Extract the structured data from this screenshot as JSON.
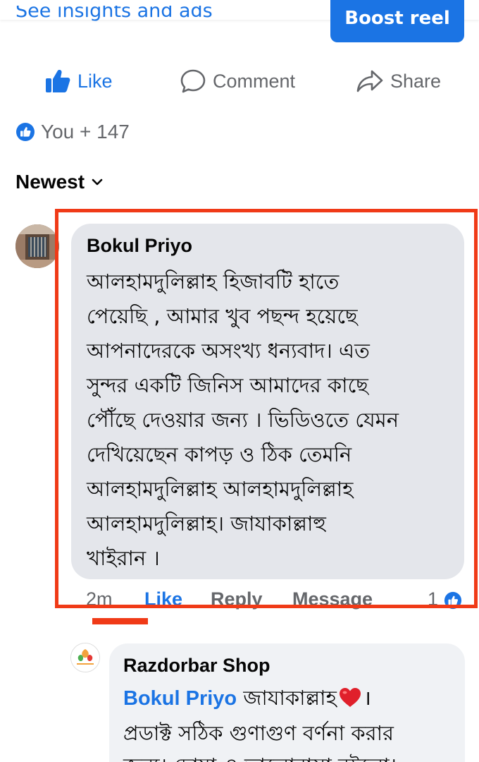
{
  "header": {
    "insights_link": "See insights and ads",
    "boost_button": "Boost reel"
  },
  "actions": {
    "like": "Like",
    "comment": "Comment",
    "share": "Share"
  },
  "reactions": {
    "summary": "You + 147",
    "icon": "like-reaction-icon"
  },
  "sort": {
    "label": "Newest",
    "icon": "chevron-down-icon"
  },
  "comments": [
    {
      "author": "Bokul Priyo",
      "lines": [
        "আলহামদুলিল্লাহ হিজাবটি হাতে",
        "পেয়েছি , আমার খুব পছন্দ হয়েছে",
        "আপনাদেরকে অসংখ্য ধন্যবাদ। এত",
        "সুন্দর  একটি জিনিস আমাদের কাছে",
        "পৌঁছে দেওয়ার জন্য । ভিডিওতে যেমন",
        "দেখিয়েছেন কাপড় ও ঠিক তেমনি",
        "আলহামদুলিল্লাহ আলহামদুলিল্লাহ",
        "আলহামদুলিল্লাহ। জাযাকাল্লাহু",
        "খাইরান ।"
      ],
      "time": "2m",
      "like_label": "Like",
      "reply_label": "Reply",
      "message_label": "Message",
      "reaction_count": "1"
    }
  ],
  "replies": [
    {
      "author": "Razdorbar Shop",
      "mention": "Bokul Priyo",
      "line1_text": "জাযাকাল্লাহ",
      "line1_end": "।",
      "line2": "প্রডাক্ট সঠিক গুণাগুণ বর্ণনা করার",
      "line3": "জন্য। দোয়া ও ভালোবাসা রইলো।"
    }
  ],
  "colors": {
    "accent": "#1b74e4",
    "highlight": "#f03a17",
    "bubble": "#e4e6eb",
    "muted_text": "#65676b"
  }
}
